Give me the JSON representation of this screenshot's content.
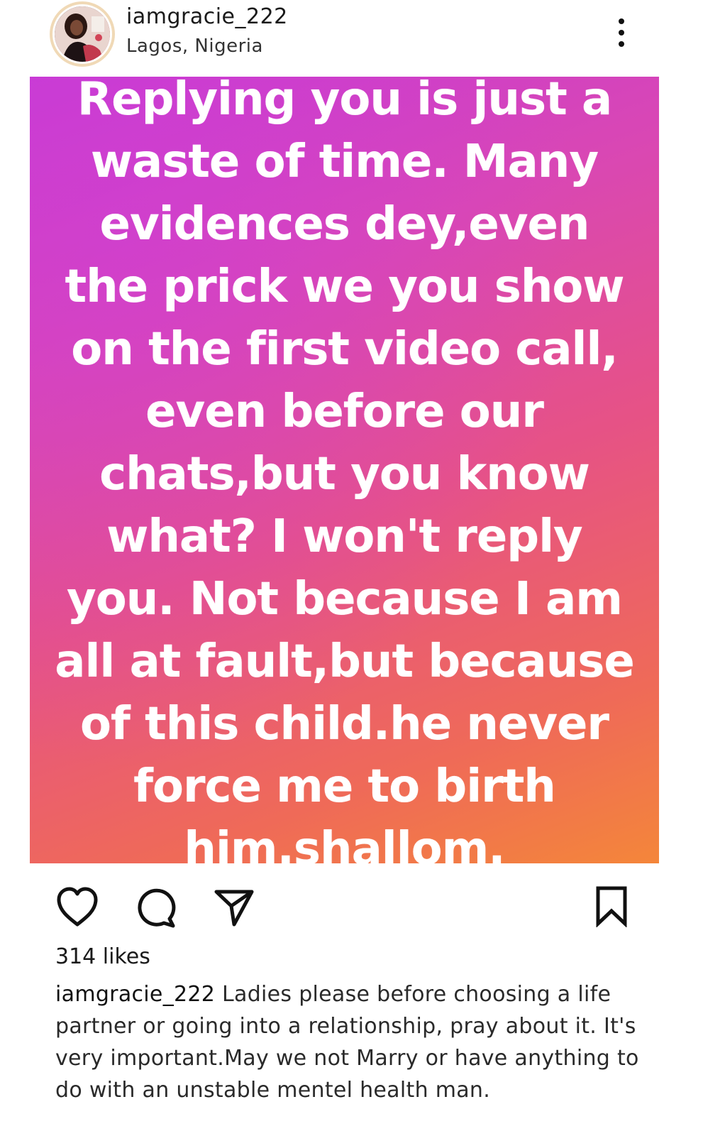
{
  "post": {
    "username": "iamgracie_222",
    "location": "Lagos, Nigeria",
    "image_text_lines": [
      "Replying you is just a",
      "waste of time. Many",
      "evidences dey,even",
      "the prick we you show",
      "on the first video call,",
      "even before our",
      "chats,but you know",
      "what? I won't reply",
      "you. Not because I am",
      "all at fault,but because",
      "of this child.he never",
      "force me to birth",
      "him.shallom."
    ],
    "likes": "314 likes",
    "caption": {
      "username": "iamgracie_222",
      "text": "Ladies please before choosing a life partner or going into a relationship, pray about it. It's very important.May we not Marry or have anything to do with an unstable mentel health man."
    }
  },
  "icons": {
    "avatar": "profile-photo",
    "more": "vertical-ellipsis-icon",
    "like": "heart-icon",
    "comment": "comment-bubble-icon",
    "share": "paper-plane-icon",
    "save": "bookmark-icon"
  },
  "colors": {
    "gradient_start": "#c63ad4",
    "gradient_mid": "#e65286",
    "gradient_end": "#f4863a",
    "post_text": "#ffffff",
    "avatar_ring": "#f0d9b6"
  }
}
